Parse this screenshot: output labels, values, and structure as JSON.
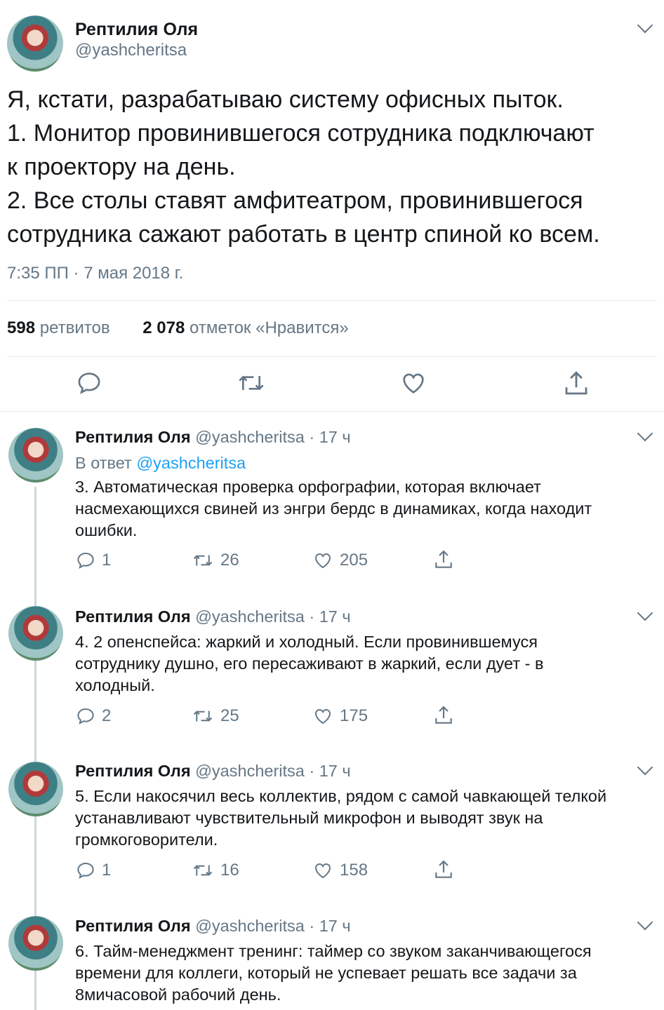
{
  "main_tweet": {
    "author_name": "Рептилия Оля",
    "author_handle": "@yashcheritsa",
    "lines": [
      "Я, кстати, разрабатываю систему офисных пыток.",
      "1. Монитор провинившегося сотрудника подключают",
      "к проектору на день.",
      "2. Все столы ставят амфитеатром, провинившегося",
      "сотрудника сажают работать в центр спиной ко всем."
    ],
    "timestamp": "7:35 ПП · 7 мая 2018 г.",
    "retweets_count": "598",
    "retweets_label": "ретвитов",
    "likes_count": "2 078",
    "likes_label": "отметок «Нравится»"
  },
  "replies": [
    {
      "author_name": "Рептилия Оля",
      "meta": "@yashcheritsa · 17 ч",
      "reply_to_prefix": "В ответ",
      "reply_to_handle": "@yashcheritsa",
      "lines": [
        "3. Автоматическая проверка орфографии, которая включает",
        "насмехающихся свиней из энгри бердс в динамиках, когда находит",
        "ошибки."
      ],
      "replies": "1",
      "retweets": "26",
      "likes": "205"
    },
    {
      "author_name": "Рептилия Оля",
      "meta": "@yashcheritsa · 17 ч",
      "lines": [
        "4. 2 опенспейса: жаркий и холодный. Если провинившемуся",
        "сотруднику душно, его пересаживают в жаркий, если дует - в",
        "холодный."
      ],
      "replies": "2",
      "retweets": "25",
      "likes": "175"
    },
    {
      "author_name": "Рептилия Оля",
      "meta": "@yashcheritsa · 17 ч",
      "lines": [
        "5. Если накосячил весь коллектив, рядом с самой чавкающей телкой",
        "устанавливают чувствительный микрофон и выводят звук на",
        "громкоговорители."
      ],
      "replies": "1",
      "retweets": "16",
      "likes": "158"
    },
    {
      "author_name": "Рептилия Оля",
      "meta": "@yashcheritsa · 17 ч",
      "lines": [
        "6. Тайм-менеджмент тренинг: таймер со звуком заканчивающегося",
        "времени для коллеги, который не успевает решать все задачи за",
        "8мичасовой рабочий день."
      ]
    }
  ],
  "colors": {
    "accent": "#1da1f2",
    "text": "#14171a",
    "secondary": "#657786",
    "border": "#e6ecf0"
  }
}
